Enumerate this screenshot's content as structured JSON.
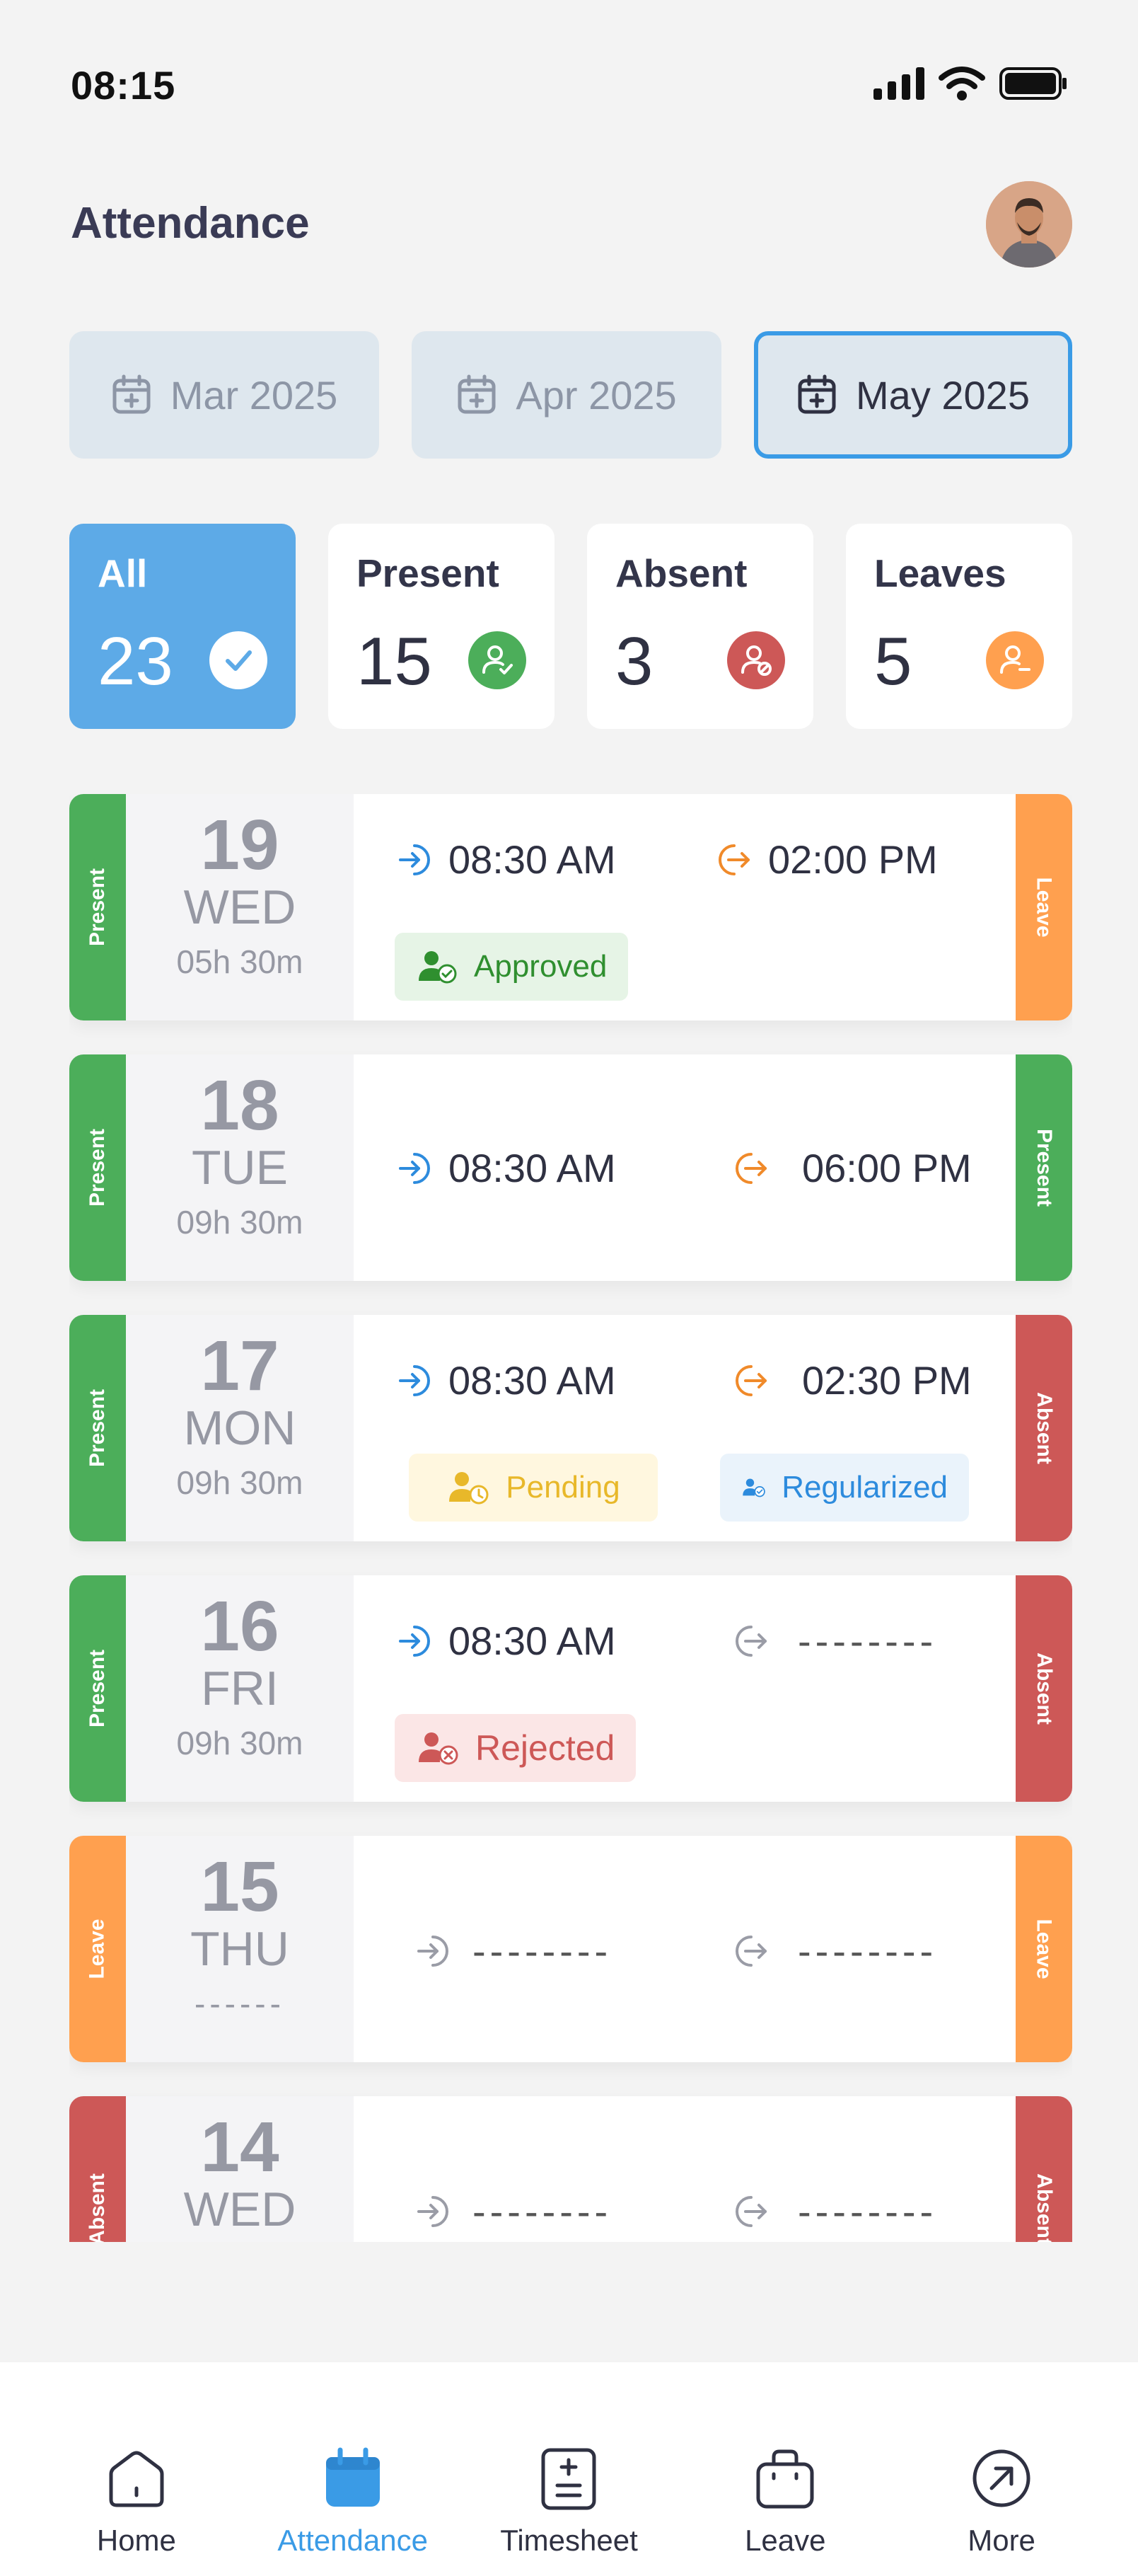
{
  "status": {
    "time": "08:15"
  },
  "header": {
    "title": "Attendance"
  },
  "months": [
    {
      "label": "Mar 2025"
    },
    {
      "label": "Apr 2025"
    },
    {
      "label": "May 2025"
    }
  ],
  "stats": [
    {
      "label": "All",
      "count": "23"
    },
    {
      "label": "Present",
      "count": "15"
    },
    {
      "label": "Absent",
      "count": "3"
    },
    {
      "label": "Leaves",
      "count": "5"
    }
  ],
  "rows": [
    {
      "status": "Present",
      "day": "19",
      "weekday": "WED",
      "hours": "05h 30m",
      "in": "08:30 AM",
      "out": "02:00 PM",
      "right": "Leave",
      "tag": "Approved"
    },
    {
      "status": "Present",
      "day": "18",
      "weekday": "TUE",
      "hours": "09h 30m",
      "in": "08:30 AM",
      "out": "06:00 PM",
      "right": "Present"
    },
    {
      "status": "Present",
      "day": "17",
      "weekday": "MON",
      "hours": "09h 30m",
      "in": "08:30 AM",
      "out": "02:30 PM",
      "right": "Absent",
      "tag": "Pending",
      "tag2": "Regularized"
    },
    {
      "status": "Present",
      "day": "16",
      "weekday": "FRI",
      "hours": "09h 30m",
      "in": "08:30 AM",
      "out": "--------",
      "right": "Absent",
      "tag": "Rejected"
    },
    {
      "status": "Leave",
      "day": "15",
      "weekday": "THU",
      "hours": "------",
      "in": "--------",
      "out": "--------",
      "right": "Leave"
    },
    {
      "status": "Absent",
      "day": "14",
      "weekday": "WED",
      "hours": "",
      "in": "--------",
      "out": "--------",
      "right": "Absent"
    }
  ],
  "nav": [
    {
      "label": "Home",
      "icon": "home-icon"
    },
    {
      "label": "Attendance",
      "icon": "calendar-icon"
    },
    {
      "label": "Timesheet",
      "icon": "timesheet-icon"
    },
    {
      "label": "Leave",
      "icon": "briefcase-icon"
    },
    {
      "label": "More",
      "icon": "arrow-circle-icon"
    }
  ],
  "colors": {
    "accent": "#3a9be6",
    "present": "#4cae5a",
    "leave": "#ffa04f",
    "absent": "#cd5857"
  }
}
